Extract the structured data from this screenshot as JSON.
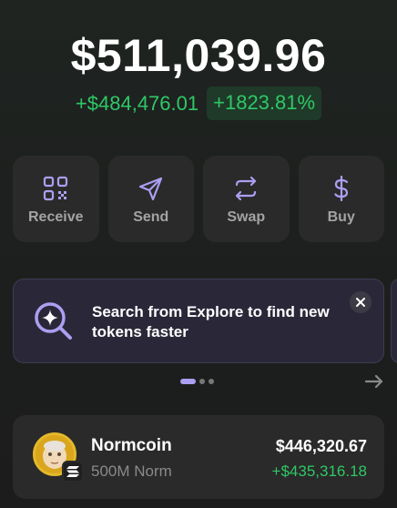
{
  "portfolio": {
    "balance": "$511,039.96",
    "change_abs": "+$484,476.01",
    "change_pct": "+1823.81%"
  },
  "actions": [
    {
      "label": "Receive",
      "icon": "qr-code-icon"
    },
    {
      "label": "Send",
      "icon": "send-icon"
    },
    {
      "label": "Swap",
      "icon": "swap-icon"
    },
    {
      "label": "Buy",
      "icon": "dollar-icon"
    }
  ],
  "banner": {
    "text": "Search from Explore to find new tokens faster",
    "icon": "search-sparkle-icon"
  },
  "carousel": {
    "pages": 3,
    "active": 0
  },
  "tokens": [
    {
      "name": "Normcoin",
      "amount": "500M Norm",
      "value": "$446,320.67",
      "change": "+$435,316.18",
      "icon": "normcoin-avatar",
      "chain_icon": "solana-icon"
    }
  ],
  "colors": {
    "accent": "#ab9ff2",
    "positive": "#2ec866",
    "card": "#2a2a2a"
  }
}
